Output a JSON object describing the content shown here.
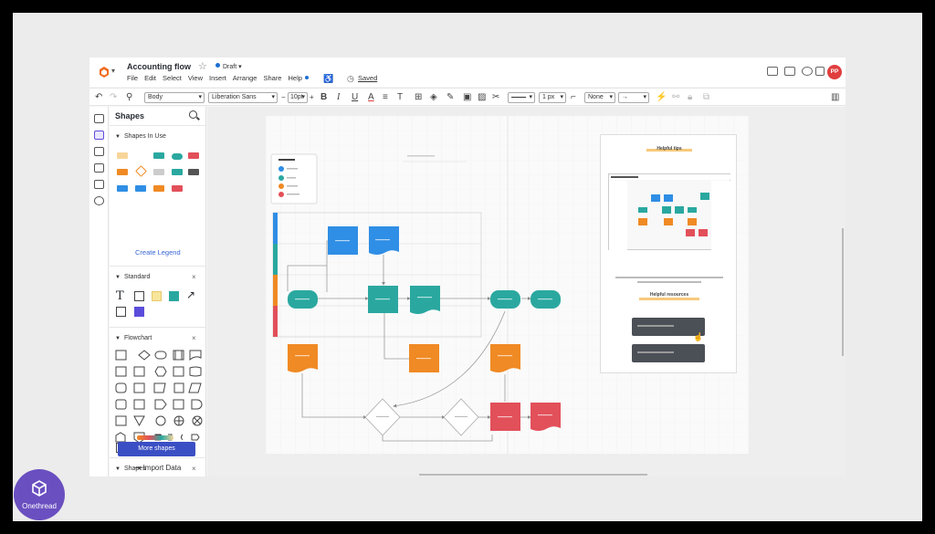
{
  "header": {
    "doc_title": "Accounting flow",
    "status": "Draft",
    "menu": [
      "File",
      "Edit",
      "Select",
      "View",
      "Insert",
      "Arrange",
      "Share",
      "Help"
    ],
    "saved": "Saved",
    "avatar_initials": "PP"
  },
  "toolbar": {
    "style": "Body",
    "font": "Liberation Sans",
    "font_size": "10pt",
    "line_width": "1 px",
    "line_start": "None"
  },
  "panel": {
    "title": "Shapes",
    "sections": {
      "in_use": "Shapes In Use",
      "standard": "Standard",
      "flowchart": "Flowchart",
      "shapes": "Shapes"
    },
    "create_legend": "Create Legend",
    "more_shapes": "More shapes",
    "import_data": "Import Data"
  },
  "tips": {
    "title": "Helpful tips",
    "resources": "Helpful resources"
  },
  "brand": {
    "name": "Onethread"
  },
  "colors": {
    "blue": "#2f8ee5",
    "teal": "#2aa8a0",
    "orange": "#f08a24",
    "red": "#e2505a",
    "accent": "#3b4fc4"
  }
}
